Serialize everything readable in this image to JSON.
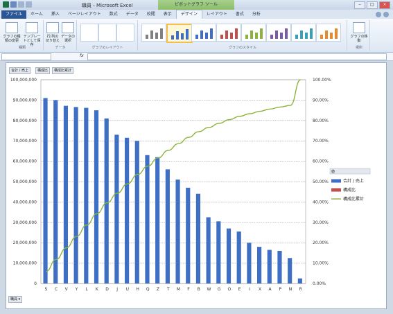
{
  "window": {
    "title": "職員 - Microsoft Excel",
    "context_tab_header": "ピボットグラフ ツール"
  },
  "tabs": [
    {
      "label": "ファイル",
      "kind": "file"
    },
    {
      "label": "ホーム"
    },
    {
      "label": "挿入"
    },
    {
      "label": "ページレイアウト"
    },
    {
      "label": "数式"
    },
    {
      "label": "データ"
    },
    {
      "label": "校閲"
    },
    {
      "label": "表示"
    },
    {
      "label": "デザイン",
      "active": true
    },
    {
      "label": "レイアウト"
    },
    {
      "label": "書式"
    },
    {
      "label": "分析"
    }
  ],
  "ribbon": {
    "groups": {
      "type": "種類",
      "data": "データ",
      "layout": "グラフのレイアウト",
      "styles": "グラフのスタイル",
      "location": "場所"
    },
    "buttons": {
      "change_type": "グラフの種類の変更",
      "save_template": "テンプレートとして保存",
      "switch_row_col": "行/列の切り替え",
      "select_data": "データの選択",
      "move_chart": "グラフの移動"
    }
  },
  "formula_bar": {
    "fx": "fx",
    "name_box": "",
    "content": ""
  },
  "pivot_buttons": {
    "values": [
      "合計 / 売上",
      "構成比",
      "構成比累計"
    ],
    "axis": "職員",
    "legend_header": "値"
  },
  "chart_data": {
    "type": "bar",
    "categories": [
      "S",
      "C",
      "V",
      "Y",
      "L",
      "K",
      "D",
      "J",
      "U",
      "H",
      "Q",
      "Z",
      "T",
      "M",
      "F",
      "B",
      "W",
      "G",
      "O",
      "E",
      "I",
      "X",
      "A",
      "P",
      "N",
      "R"
    ],
    "series": [
      {
        "name": "合計 / 売上",
        "type": "bar",
        "axis": "left",
        "color": "#3f6fc4",
        "values": [
          91000000,
          90000000,
          87200000,
          86600000,
          86200000,
          85000000,
          81000000,
          73000000,
          71500000,
          70000000,
          63000000,
          62000000,
          56000000,
          51000000,
          47000000,
          44000000,
          32500000,
          30500000,
          27000000,
          25500000,
          20000000,
          18000000,
          16500000,
          16000000,
          12500000,
          2500000
        ]
      },
      {
        "name": "構成比",
        "type": "bar",
        "axis": "right",
        "color": "#c0504d",
        "values": []
      },
      {
        "name": "構成比累計",
        "type": "line",
        "axis": "right",
        "color": "#8cb33d",
        "values": [
          0.059,
          0.118,
          0.175,
          0.231,
          0.287,
          0.343,
          0.396,
          0.443,
          0.489,
          0.535,
          0.576,
          0.616,
          0.653,
          0.686,
          0.717,
          0.745,
          0.766,
          0.786,
          0.804,
          0.82,
          0.833,
          0.845,
          0.856,
          0.866,
          0.874,
          1.0
        ]
      }
    ],
    "left_axis": {
      "ylim": [
        0,
        100000000
      ],
      "ticks": [
        "0",
        "10,000,000",
        "20,000,000",
        "30,000,000",
        "40,000,000",
        "50,000,000",
        "60,000,000",
        "70,000,000",
        "80,000,000",
        "90,000,000",
        "100,000,000"
      ]
    },
    "right_axis": {
      "ylim": [
        0,
        1
      ],
      "ticks": [
        "0.00%",
        "10.00%",
        "20.00%",
        "30.00%",
        "40.00%",
        "50.00%",
        "60.00%",
        "70.00%",
        "80.00%",
        "90.00%",
        "100.00%"
      ]
    },
    "grid": true,
    "legend": "right"
  },
  "colors": {
    "bar": "#3f6fc4",
    "bar_red": "#c0504d",
    "line": "#8cb33d",
    "file_tab": "#2b5797",
    "context_tab": "#9cc77a"
  }
}
